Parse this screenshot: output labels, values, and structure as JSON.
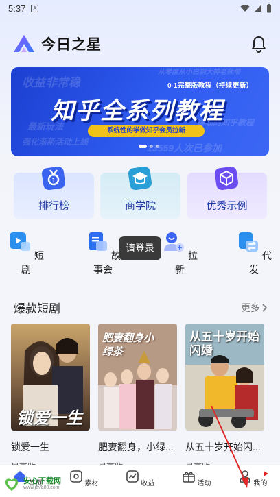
{
  "status_bar": {
    "time": "5:37"
  },
  "header": {
    "app_title": "今日之星"
  },
  "banner": {
    "main_title": "知乎全系列教程",
    "sub_tag": "0-1完整版教程（持续更新）",
    "pill_text": "系统性的学做知乎会员拉新",
    "bg_text_1": "收益非常稳",
    "bg_text_2": "最新玩法",
    "bg_text_3": "强化渐新活动上线",
    "bg_text_4": "13559人次已参加",
    "bg_text_5": "详细的知乎教程",
    "bg_text_6": "从零度从小白到大神老师带",
    "slide_count": 3,
    "active_slide": 1
  },
  "cards": [
    {
      "label": "排行榜",
      "icon": "medal-icon"
    },
    {
      "label": "商学院",
      "icon": "graduation-cap-icon"
    },
    {
      "label": "优秀示例",
      "icon": "cube-icon"
    }
  ],
  "quick_actions": [
    {
      "label": "短剧",
      "icon": "play-video-icon"
    },
    {
      "label": "故事会",
      "icon": "book-icon"
    },
    {
      "label": "拉新",
      "icon": "add-user-icon"
    },
    {
      "label": "代发",
      "icon": "swap-icon"
    }
  ],
  "toast": {
    "text": "请登录"
  },
  "section": {
    "title": "爆款短剧",
    "more": "更多"
  },
  "dramas": [
    {
      "title": "锁爱一生",
      "tag": "最高收",
      "poster_text": "锁爱一生"
    },
    {
      "title": "肥妻翻身，小绿...",
      "tag": "最高收",
      "poster_text": "肥妻翻身小绿茶"
    },
    {
      "title": "从五十岁开始闪...",
      "tag": "最高收",
      "poster_text": "从五十岁开始闪婚"
    }
  ],
  "tabbar": [
    {
      "label": "首页",
      "icon": "home-icon"
    },
    {
      "label": "素材",
      "icon": "material-icon"
    },
    {
      "label": "收益",
      "icon": "chart-icon"
    },
    {
      "label": "活动",
      "icon": "gift-icon"
    },
    {
      "label": "我的",
      "icon": "user-icon"
    }
  ],
  "watermark": {
    "text": "安心下载网",
    "url": "www.java80.com"
  },
  "colors": {
    "primary": "#2f5cf0",
    "banner_pill": "#f2c21a",
    "card_text": "#1f3aa8"
  }
}
